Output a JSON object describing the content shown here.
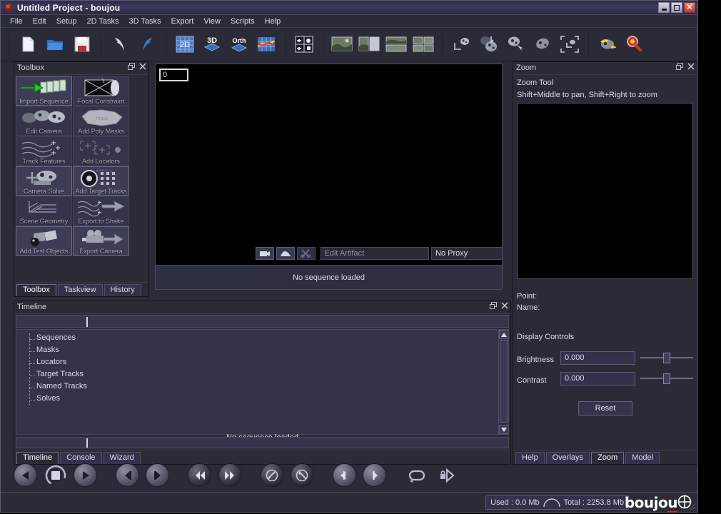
{
  "window": {
    "title": "Untitled Project - boujou",
    "icon": "boujou-app-icon",
    "buttons": {
      "minimize": "minimize",
      "maximize": "maximize",
      "close": "close"
    }
  },
  "menubar": {
    "items": [
      "File",
      "Edit",
      "Setup",
      "2D Tasks",
      "3D Tasks",
      "Export",
      "View",
      "Scripts",
      "Help"
    ]
  },
  "toolbar": {
    "groups": [
      {
        "name": "file",
        "buttons": [
          {
            "name": "new-icon",
            "label": "New"
          },
          {
            "name": "open-folder-icon",
            "label": "Open"
          },
          {
            "name": "save-floppy-icon",
            "label": "Save"
          }
        ]
      },
      {
        "name": "history",
        "buttons": [
          {
            "name": "undo-arrow-icon",
            "label": "Undo"
          },
          {
            "name": "redo-arrow-icon",
            "label": "Redo"
          }
        ]
      },
      {
        "name": "views",
        "buttons": [
          {
            "name": "view-2d-icon",
            "label": "2D"
          },
          {
            "name": "view-3d-icon",
            "label": "3D"
          },
          {
            "name": "view-orth-icon",
            "label": "Orth"
          },
          {
            "name": "graph-curves-icon",
            "label": "Graph"
          }
        ]
      },
      {
        "name": "layout-quad",
        "buttons": [
          {
            "name": "quad-layout-icon",
            "label": "Quad Layout"
          }
        ]
      },
      {
        "name": "layouts",
        "buttons": [
          {
            "name": "single-pane-icon",
            "label": "Single"
          },
          {
            "name": "two-pane-vertical-icon",
            "label": "Two Vertical"
          },
          {
            "name": "two-pane-horizontal-icon",
            "label": "Two Horizontal"
          },
          {
            "name": "four-pane-icon",
            "label": "Four Pane"
          }
        ]
      },
      {
        "name": "camera-tools",
        "buttons": [
          {
            "name": "camera-path-icon",
            "label": "Camera Path"
          },
          {
            "name": "camera-solve-icon",
            "label": "Camera Solve"
          },
          {
            "name": "camera-move-icon",
            "label": "Move Camera"
          },
          {
            "name": "camera-rotate-icon",
            "label": "Rotate Camera"
          },
          {
            "name": "camera-frame-icon",
            "label": "Frame Camera"
          }
        ]
      },
      {
        "name": "highlight-tools",
        "buttons": [
          {
            "name": "camera-highlight-icon",
            "label": "Highlight Camera"
          },
          {
            "name": "magnifier-red-icon",
            "label": "Zoom Tool"
          }
        ]
      }
    ]
  },
  "toolbox": {
    "title": "Toolbox",
    "float_btn": "float-icon",
    "close_btn": "close-icon",
    "cells": [
      {
        "name": "import-sequence",
        "label": "Import Sequence",
        "enabled": true
      },
      {
        "name": "focal-constraint",
        "label": "Focal Constraint",
        "enabled": false
      },
      {
        "name": "edit-camera",
        "label": "Edit Camera",
        "enabled": true
      },
      {
        "name": "add-poly-masks",
        "label": "Add Poly Masks",
        "enabled": false
      },
      {
        "name": "track-features",
        "label": "Track Features",
        "enabled": false
      },
      {
        "name": "add-locators",
        "label": "Add Locators",
        "enabled": false
      },
      {
        "name": "camera-solve",
        "label": "Camera Solve",
        "enabled": true
      },
      {
        "name": "add-target-tracks",
        "label": "Add Target Tracks",
        "enabled": true
      },
      {
        "name": "scene-geometry",
        "label": "Scene Geometry",
        "enabled": false
      },
      {
        "name": "export-to-shake",
        "label": "Export to Shake",
        "enabled": false
      },
      {
        "name": "add-test-objects",
        "label": "Add Test Objects",
        "enabled": true
      },
      {
        "name": "export-camera",
        "label": "Export Camera",
        "enabled": true
      }
    ],
    "tabs": [
      {
        "label": "Toolbox",
        "selected": true
      },
      {
        "label": "Taskview",
        "selected": false
      },
      {
        "label": "History",
        "selected": false
      }
    ]
  },
  "viewport": {
    "frame_value": "0",
    "bar": {
      "btn_camera": "camera-icon",
      "btn_mask": "mask-icon",
      "btn_scissors": "scissors-icon",
      "artifact_placeholder": "Edit Artifact",
      "proxy_value": "No Proxy"
    },
    "status": "No sequence loaded"
  },
  "timeline": {
    "title": "Timeline",
    "float_btn": "float-icon",
    "close_btn": "close-icon",
    "tree": [
      "Sequences",
      "Masks",
      "Locators",
      "Target Tracks",
      "Named Tracks",
      "Solves"
    ],
    "status": "No sequence loaded",
    "tabs": [
      {
        "label": "Timeline",
        "selected": true
      },
      {
        "label": "Console",
        "selected": false
      },
      {
        "label": "Wizard",
        "selected": false
      }
    ]
  },
  "zoom_panel": {
    "title": "Zoom",
    "float_btn": "float-icon",
    "close_btn": "close-icon",
    "tool_name": "Zoom Tool",
    "hint": "Shift+Middle to pan, Shift+Right to zoom",
    "point_label": "Point:",
    "point_value": "",
    "name_label": "Name:",
    "name_value": "",
    "display_controls_label": "Display Controls",
    "brightness_label": "Brightness",
    "brightness_value": "0.000",
    "contrast_label": "Contrast",
    "contrast_value": "0.000",
    "reset_label": "Reset",
    "tabs": [
      {
        "label": "Help",
        "selected": false
      },
      {
        "label": "Overlays",
        "selected": false
      },
      {
        "label": "Zoom",
        "selected": true
      },
      {
        "label": "Model",
        "selected": false
      }
    ]
  },
  "transport": {
    "buttons": [
      {
        "name": "play-reverse-button",
        "label": "Play Reverse"
      },
      {
        "name": "stop-button",
        "label": "Stop"
      },
      {
        "name": "play-forward-button",
        "label": "Play Forward"
      },
      {
        "name": "step-back-button",
        "label": "Step Back"
      },
      {
        "name": "step-forward-button",
        "label": "Step Forward"
      },
      {
        "name": "go-to-start-button",
        "label": "Go To Start"
      },
      {
        "name": "go-to-end-button",
        "label": "Go To End"
      },
      {
        "name": "prev-keyframe-button",
        "label": "Previous Keyframe"
      },
      {
        "name": "next-keyframe-button",
        "label": "Next Keyframe"
      },
      {
        "name": "prev-marker-button",
        "label": "Previous Marker"
      },
      {
        "name": "next-marker-button",
        "label": "Next Marker"
      },
      {
        "name": "loop-toggle-button",
        "label": "Loop"
      },
      {
        "name": "lock-range-button",
        "label": "Lock Range"
      }
    ]
  },
  "statusbar": {
    "used_label": "Used : 0.0 Mb",
    "total_label": "Total : 2253.8 Mb",
    "brand_prefix": "boujo",
    "brand_u": "u",
    "brand_mark": "circle-plus-icon"
  },
  "colors": {
    "panel_bg": "#2b2b38",
    "panel_alt": "#33334a",
    "border": "#4b4b60",
    "text": "#dcdce6",
    "accent_red": "#c0392b",
    "accent_blue": "#4a7fd4",
    "viewport_black": "#000000"
  }
}
